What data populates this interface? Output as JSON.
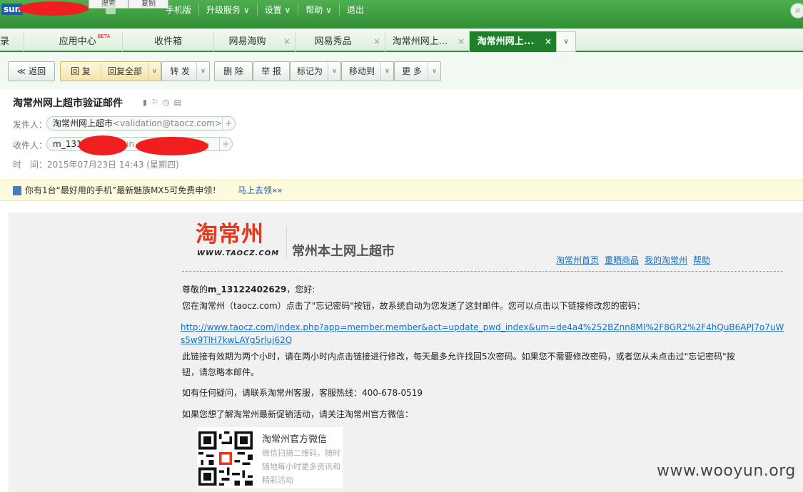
{
  "topbar": {
    "logo_text": "sun",
    "mini_buttons": [
      "搜索",
      "复制"
    ],
    "nav": [
      "手机版",
      "升级服务",
      "设置",
      "帮助",
      "退出"
    ],
    "search_icon": "search-icon"
  },
  "tabs": [
    {
      "label": "录"
    },
    {
      "label": "应用中心",
      "badge": "BETA"
    },
    {
      "label": "收件箱"
    },
    {
      "label": "网易海购",
      "close": "×"
    },
    {
      "label": "网易秀品",
      "close": "×"
    },
    {
      "label": "淘常州网上...",
      "close": "×"
    },
    {
      "label": "淘常州网上...",
      "close": "×"
    }
  ],
  "tabs_more_icon": "chevron-down-icon",
  "toolbar": {
    "back": "≪ 返回",
    "reply": "回 复",
    "reply_all": "回复全部",
    "forward": "转 发",
    "delete": "删 除",
    "report": "举 报",
    "mark_as": "标记为",
    "move_to": "移动到",
    "more": "更 多"
  },
  "email": {
    "subject": "淘常州网上超市验证邮件",
    "from_label": "发件人：",
    "from_name": "淘常州网上超市",
    "from_email": "<validation@taocz.com>",
    "to_label": "收件人：",
    "to_prefix": "m_131",
    "to_mid": "sun",
    "to_suffix": "»",
    "time_label": "时　间：",
    "time_value": "2015年07月23日 14:43 (星期四)"
  },
  "ad": {
    "text": "你有1台“最好用的手机”最新魅族MX5可免费申领！",
    "link": "马上去领»»"
  },
  "body": {
    "logo_cn": "淘常州",
    "logo_url": "WWW.TAOCZ.COM",
    "slogan": "常州本土网上超市",
    "nav": [
      "淘常州首页",
      "重晒商品",
      "我的淘常州",
      "帮助"
    ],
    "greeting_prefix": "尊敬的",
    "username": "m_13122402629",
    "greeting_suffix": "，您好:",
    "line1": "您在淘常州（taocz.com）点击了\"忘记密码\"按钮，故系统自动为您发送了这封邮件。您可以点击以下链接修改您的密码：",
    "reset_link": "http://www.taocz.com/index.php?app=member.member&act=update_pwd_index&um=de4a4%252BZnn8MI%2F8GR2%2F4hQuB6APJ7o7uWs5w9TlH7kwLAYg5rluj62Q",
    "line2a": "此链接有效期为两个小时，请在两小时内点击链接进行修改，每天最多允许找回5次密码。如果您不需要修改密码，或者您从未点击过\"忘记密码\"按",
    "line2b": "钮，请忽略本邮件。",
    "line3": "如有任何疑问，请联系淘常州客服，客服热线：400-678-0519",
    "line4": "如果您想了解淘常州最新促销活动，请关注淘常州官方微信：",
    "qr_title": "淘常州官方微信",
    "qr_desc": "微信扫描二维码，随时随地每小时更多资讯和精彩活动"
  },
  "watermark": "www.wooyun.org"
}
